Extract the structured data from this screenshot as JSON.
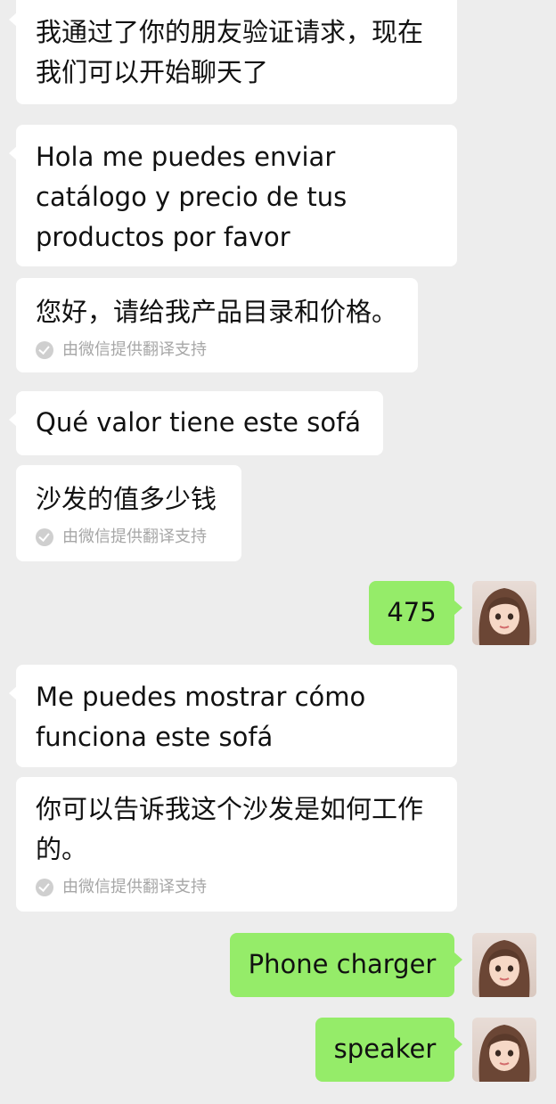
{
  "messages": [
    {
      "text": "我通过了你的朋友验证请求，现在\n我们可以开始聊天了"
    },
    {
      "text": "Hola me puedes enviar\ncatálogo y precio de tus\nproductos por favor"
    },
    {
      "text": "您好，请给我产品目录和价格。",
      "note": "由微信提供翻译支持"
    },
    {
      "text": "Qué valor tiene este sofá"
    },
    {
      "text": "沙发的值多少钱",
      "note": "由微信提供翻译支持"
    },
    {
      "text": "475"
    },
    {
      "text": "Me puedes mostrar cómo\nfunciona este sofá"
    },
    {
      "text": "你可以告诉我这个沙发是如何工作\n的。",
      "note": "由微信提供翻译支持"
    },
    {
      "text": "Phone charger"
    },
    {
      "text": "speaker"
    }
  ],
  "colors": {
    "background": "#ededed",
    "incoming_bubble": "#ffffff",
    "outgoing_bubble": "#95ec69",
    "note_text": "#a7a7a7"
  },
  "icons": {
    "translation_check": "check-circle-icon",
    "self_avatar": "avatar"
  }
}
